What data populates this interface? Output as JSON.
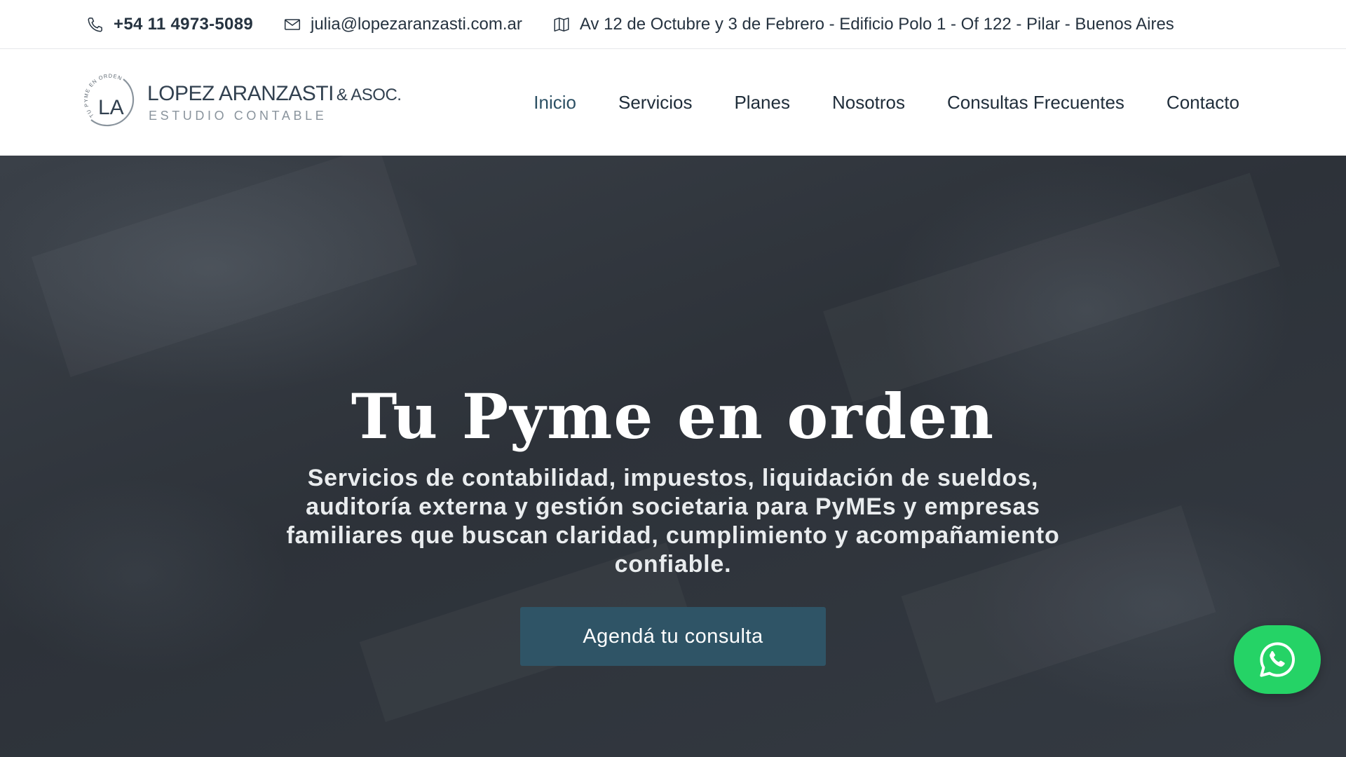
{
  "topbar": {
    "phone": "+54 11 4973-5089",
    "email": "julia@lopezaranzasti.com.ar",
    "address": "Av 12 de Octubre y 3 de Febrero - Edificio Polo 1 - Of 122 - Pilar - Buenos Aires",
    "icons": {
      "phone": "phone-icon",
      "email": "envelope-icon",
      "address": "map-icon"
    }
  },
  "logo": {
    "initials": "LA",
    "ring_text": "TU PYME EN ORDEN",
    "name": "LOPEZ ARANZASTI",
    "suffix": "& ASOC.",
    "tagline": "ESTUDIO CONTABLE"
  },
  "nav": {
    "items": [
      {
        "label": "Inicio",
        "active": true
      },
      {
        "label": "Servicios"
      },
      {
        "label": "Planes"
      },
      {
        "label": "Nosotros"
      },
      {
        "label": "Consultas Frecuentes"
      },
      {
        "label": "Contacto"
      }
    ]
  },
  "hero": {
    "title": "Tu Pyme en orden",
    "description": "Servicios de contabilidad, impuestos, liquidación de sueldos, auditoría externa y gestión societaria para PyMEs y empresas familiares que buscan claridad, cumplimiento y acompañamiento confiable.",
    "cta_label": "Agendá tu consulta"
  },
  "whatsapp": {
    "icon": "whatsapp-icon"
  },
  "colors": {
    "accent": "#2f5466",
    "nav_active": "#2c5064",
    "whatsapp": "#25d366",
    "hero_overlay": "#2d3239"
  }
}
